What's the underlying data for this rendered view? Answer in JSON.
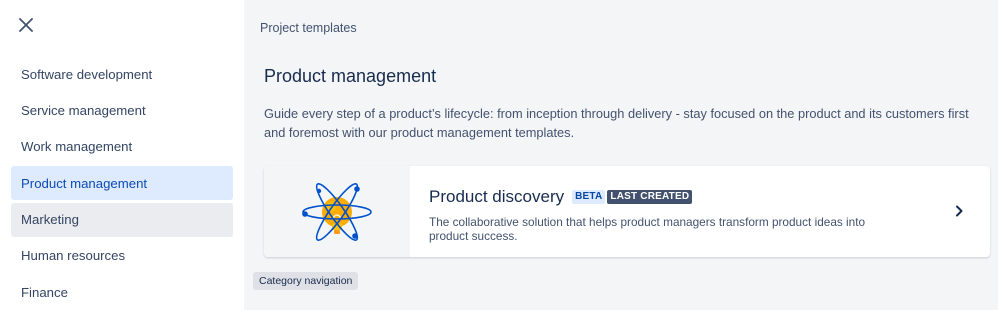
{
  "sidebar": {
    "close_icon": "close-icon",
    "items": [
      {
        "label": "Software development"
      },
      {
        "label": "Service management"
      },
      {
        "label": "Work management"
      },
      {
        "label": "Product management",
        "active": true
      },
      {
        "label": "Marketing",
        "hover": true
      },
      {
        "label": "Human resources"
      },
      {
        "label": "Finance"
      }
    ]
  },
  "main": {
    "breadcrumb": "Project templates",
    "title": "Product management",
    "description": "Guide every step of a product’s lifecycle: from inception through delivery - stay focused on the product and its customers first and foremost with our product management templates.",
    "card": {
      "title": "Product discovery",
      "badge_beta": "BETA",
      "badge_last": "LAST CREATED",
      "description": "The collaborative solution that helps product managers transform product ideas into product success.",
      "icon": "chevron-right-icon"
    }
  },
  "tooltip": "Category navigation",
  "colors": {
    "active_bg": "#deebff",
    "active_text": "#0c4bb5",
    "hover_bg": "#ebecf0",
    "beta_bg": "#deebff",
    "beta_text": "#0747a6",
    "last_bg": "#42526e"
  }
}
